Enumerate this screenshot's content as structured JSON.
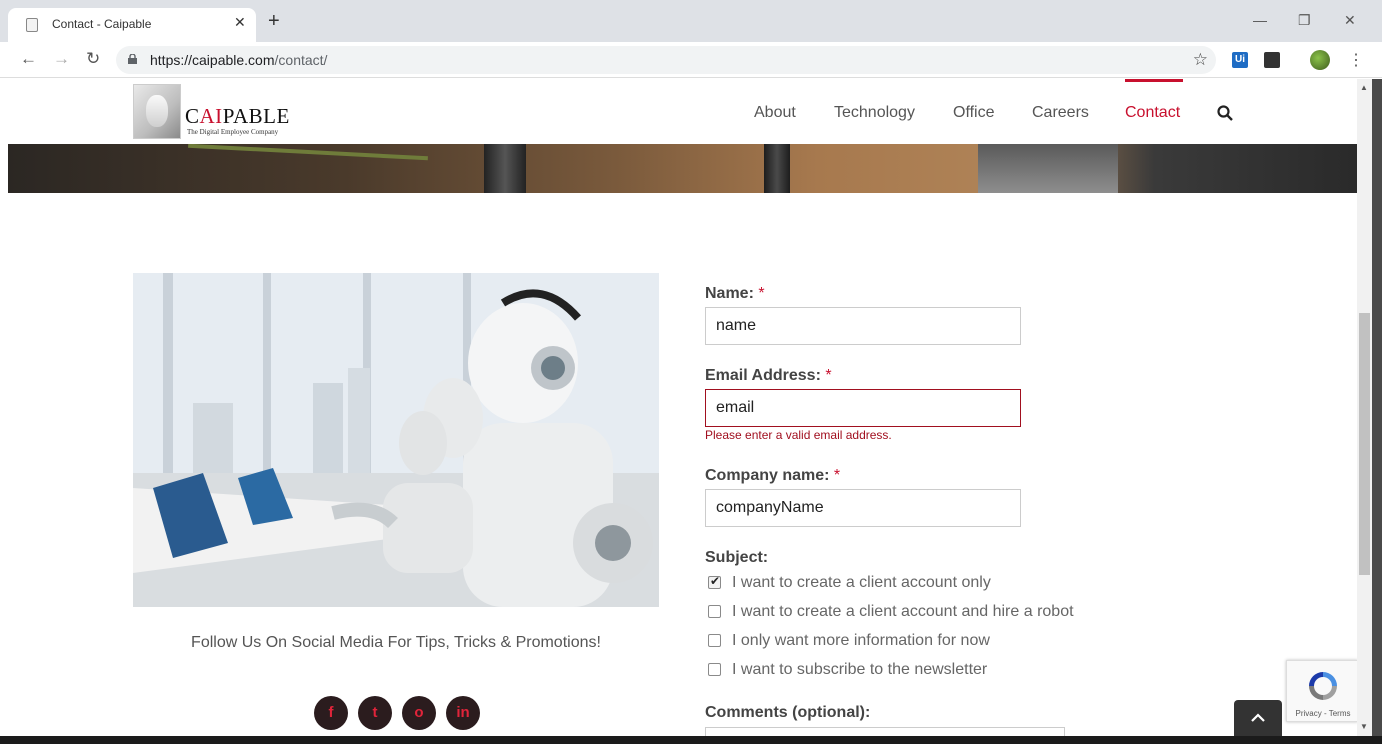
{
  "browser": {
    "tab_title": "Contact - Caipable",
    "url_host": "https://caipable.com",
    "url_path": "/contact/",
    "ext_label": "Ui"
  },
  "site": {
    "logo_prefix": "C",
    "logo_accent": "AI",
    "logo_suffix": "PABLE",
    "tagline": "The Digital Employee Company",
    "nav": [
      {
        "label": "About"
      },
      {
        "label": "Technology"
      },
      {
        "label": "Office"
      },
      {
        "label": "Careers"
      },
      {
        "label": "Contact"
      }
    ],
    "accent_color": "#c8102e"
  },
  "social": {
    "follow_text": "Follow Us On Social Media For Tips, Tricks & Promotions!",
    "icons": [
      {
        "name": "facebook-icon",
        "glyph": "f"
      },
      {
        "name": "twitter-icon",
        "glyph": "t"
      },
      {
        "name": "instagram-icon",
        "glyph": "o"
      },
      {
        "name": "linkedin-icon",
        "glyph": "in"
      }
    ]
  },
  "form": {
    "name_label": "Name:",
    "name_value": "name",
    "email_label": "Email Address:",
    "email_value": "email",
    "email_error": "Please enter a valid email address.",
    "company_label": "Company name:",
    "company_value": "companyName",
    "required_mark": "*",
    "subject_label": "Subject:",
    "subjects": [
      {
        "label": "I want to create a client account only",
        "checked": true
      },
      {
        "label": "I want to create a client account and hire a robot",
        "checked": false
      },
      {
        "label": "I only want more information for now",
        "checked": false
      },
      {
        "label": "I want to subscribe to the newsletter",
        "checked": false
      }
    ],
    "comments_label": "Comments (optional):"
  },
  "recaptcha": {
    "text": "Privacy - Terms"
  }
}
